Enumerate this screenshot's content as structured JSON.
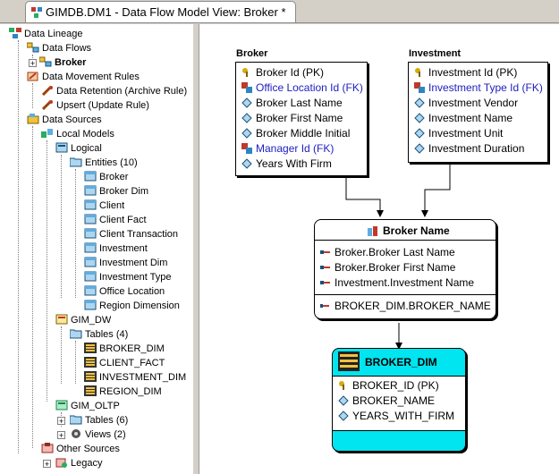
{
  "tab": {
    "title": "GIMDB.DM1 - Data Flow Model View: Broker *"
  },
  "tree": {
    "root": "Data Lineage",
    "data_flows": "Data Flows",
    "broker_flow": "Broker",
    "rules": "Data Movement Rules",
    "rule1": "Data Retention (Archive Rule)",
    "rule2": "Upsert (Update Rule)",
    "sources": "Data Sources",
    "local_models": "Local Models",
    "logical": "Logical",
    "entities": "Entities (10)",
    "entity_items": [
      "Broker",
      "Broker Dim",
      "Client",
      "Client Fact",
      "Client Transaction",
      "Investment",
      "Investment Dim",
      "Investment Type",
      "Office Location",
      "Region Dimension"
    ],
    "gim_dw": "GIM_DW",
    "tables4": "Tables (4)",
    "table_items": [
      "BROKER_DIM",
      "CLIENT_FACT",
      "INVESTMENT_DIM",
      "REGION_DIM"
    ],
    "gim_oltp": "GIM_OLTP",
    "tables6": "Tables (6)",
    "views2": "Views (2)",
    "other_sources": "Other Sources",
    "legacy": "Legacy"
  },
  "diagram": {
    "broker": {
      "title": "Broker",
      "attrs": [
        "Broker Id (PK)",
        "Office Location Id (FK)",
        "Broker Last Name",
        "Broker First Name",
        "Broker Middle Initial",
        "Manager Id (FK)",
        "Years With Firm"
      ]
    },
    "investment": {
      "title": "Investment",
      "attrs": [
        "Investment Id (PK)",
        "Investment Type Id (FK)",
        "Investment Vendor",
        "Investment Name",
        "Investment Unit",
        "Investment Duration"
      ]
    },
    "rule": {
      "title": "Broker Name",
      "inputs": [
        "Broker.Broker Last Name",
        "Broker.Broker First Name",
        "Investment.Investment Name"
      ],
      "output": "BROKER_DIM.BROKER_NAME"
    },
    "target": {
      "title": "BROKER_DIM",
      "attrs": [
        "BROKER_ID (PK)",
        "BROKER_NAME",
        "YEARS_WITH_FIRM"
      ]
    }
  }
}
